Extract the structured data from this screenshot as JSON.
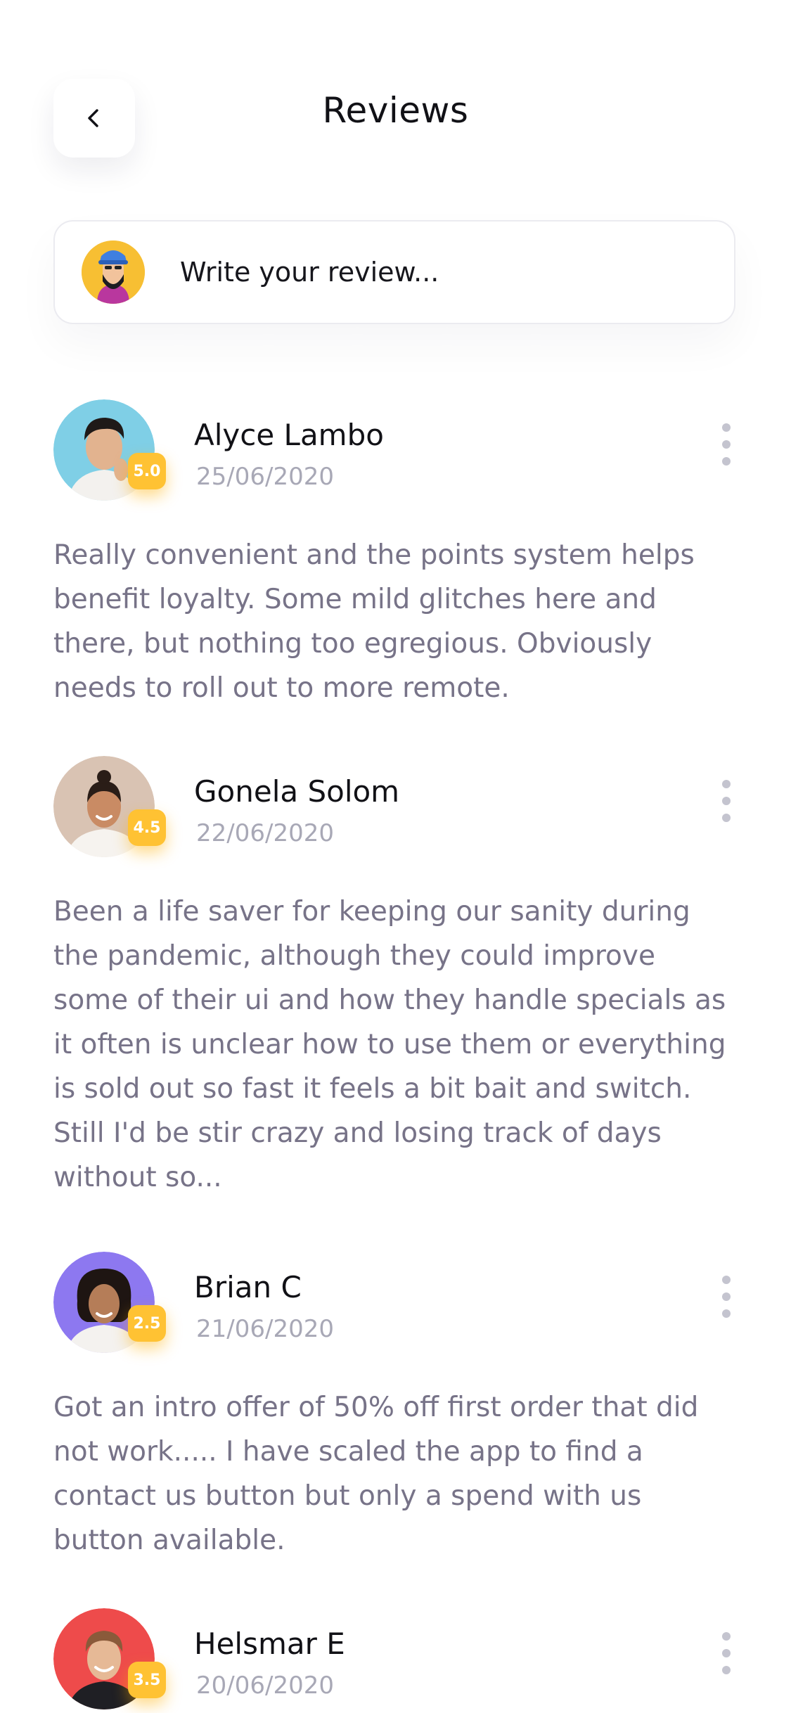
{
  "header": {
    "title": "Reviews"
  },
  "composer": {
    "placeholder": "Write your review..."
  },
  "reviews": [
    {
      "name": "Alyce Lambo",
      "date": "25/06/2020",
      "rating": "5.0",
      "text": "Really convenient and the points system helps benefit loyalty. Some mild glitches here and there, but nothing too egregious. Obviously needs to roll out to more remote."
    },
    {
      "name": "Gonela Solom",
      "date": "22/06/2020",
      "rating": "4.5",
      "text": "Been a life saver for keeping our sanity during the pandemic, although they could improve some of their ui and how they handle specials as it often is unclear how to use them or everything is sold out so fast it feels a bit bait and switch. Still I'd be stir crazy and losing track of days without so..."
    },
    {
      "name": "Brian C",
      "date": "21/06/2020",
      "rating": "2.5",
      "text": "Got an intro offer of 50% off first order that did not work..... I have scaled the app to find a contact us button but only a spend with us button available."
    },
    {
      "name": "Helsmar E",
      "date": "20/06/2020",
      "rating": "3.5",
      "text": ""
    }
  ],
  "colors": {
    "badge": "#ffc233",
    "body_text": "#777388",
    "date_text": "#a8a8b6"
  },
  "icons": {
    "back": "chevron-left-icon",
    "more": "more-vertical-icon"
  }
}
